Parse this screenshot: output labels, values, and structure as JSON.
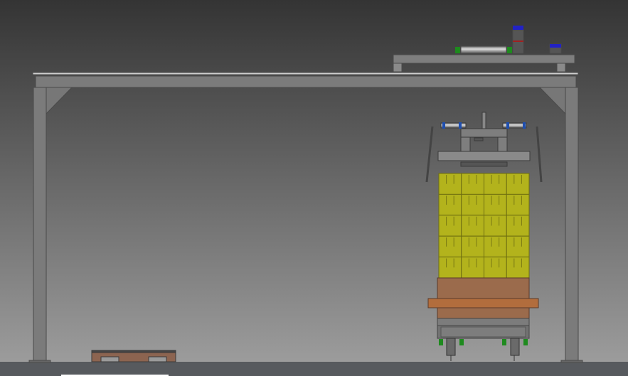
{
  "scene": {
    "colors": {
      "bg_top": "#343434",
      "bg_bottom": "#9c9c9c",
      "steel": "#7b7b7b",
      "steel_edge": "#4a4a4a",
      "floor": "#575a5e",
      "load": "#b3b31c",
      "pallet": "#9b6b4c",
      "pallet_plate": "#b26d3d",
      "valve_green": "#1e8a1e",
      "motor_blue": "#2020c0"
    }
  }
}
